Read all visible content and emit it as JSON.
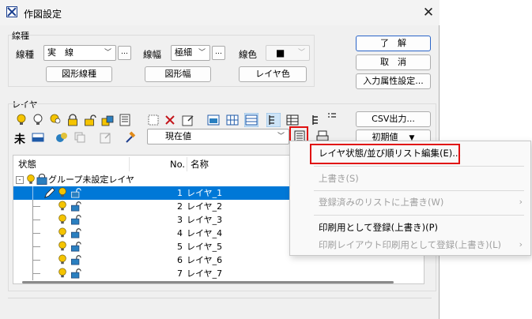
{
  "window": {
    "title": "作図設定",
    "close_glyph": "✕"
  },
  "line_group": {
    "label": "線種",
    "linetype_label": "線種",
    "linetype_value": "実　線",
    "linewidth_label": "線幅",
    "linewidth_value": "極細",
    "color_label": "線色",
    "color_value": "■",
    "more_glyph": "…",
    "btn_shape_linetype": "図形線種",
    "btn_shape_width": "図形幅",
    "btn_layer_color": "レイヤ色"
  },
  "side_buttons": {
    "ok": "了　解",
    "cancel": "取　消",
    "input_attr": "入力属性設定..."
  },
  "layer_group": {
    "label": "レイヤ",
    "csv_button": "CSV出力...",
    "current_combo": "現在値",
    "initial_combo": "初期値",
    "tools_row2_text": "未"
  },
  "tree": {
    "col_state": "状態",
    "col_no": "No.",
    "col_name": "名称",
    "group_row": "グループ未設定レイヤ",
    "rows": [
      {
        "no": "1",
        "name": "レイヤ_1"
      },
      {
        "no": "2",
        "name": "レイヤ_2"
      },
      {
        "no": "3",
        "name": "レイヤ_3"
      },
      {
        "no": "4",
        "name": "レイヤ_4"
      },
      {
        "no": "5",
        "name": "レイヤ_5"
      },
      {
        "no": "6",
        "name": "レイヤ_6"
      },
      {
        "no": "7",
        "name": "レイヤ_7"
      }
    ]
  },
  "context_menu": {
    "items": [
      {
        "label": "レイヤ状態/並び順リスト編集(E)...",
        "enabled": true
      },
      {
        "label": "上書き(S)",
        "enabled": false
      },
      {
        "label": "登録済みのリストに上書き(W)",
        "enabled": false,
        "submenu": true
      },
      {
        "label": "印刷用として登録(上書き)(P)",
        "enabled": true
      },
      {
        "label": "印刷レイアウト印刷用として登録(上書き)(L)",
        "enabled": false,
        "submenu": true
      }
    ],
    "submenu_glyph": "›"
  },
  "colors": {
    "selection": "#0078d7",
    "highlight_box": "#e01010",
    "bulb": "#f5c400",
    "lock": "#2a7fc0"
  }
}
